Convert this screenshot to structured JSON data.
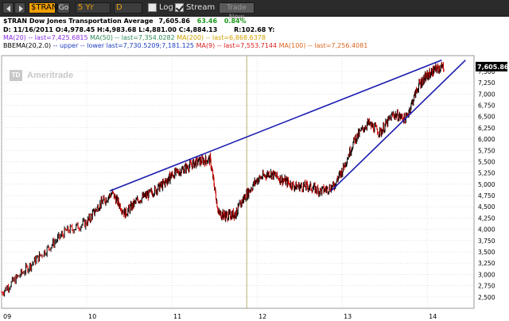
{
  "toolbar": {
    "symbol": "$TRAN",
    "go_label": "Go",
    "period": "5 Yr",
    "interval": "D",
    "log_label": "Log",
    "log_checked": false,
    "stream_label": "Stream",
    "stream_checked": true,
    "trade_label": "Trade Now"
  },
  "header": {
    "title": "$TRAN Dow Jones Transportation Average",
    "last": "7,605.86",
    "change": "63.46",
    "change_pct": "0.84%",
    "ohlc": "D: 11/16/2011  O:4,978.45  H:4,983.68  L:4,881.00  C:4,884.13",
    "range": "R:102.68  Y:",
    "ma_line": [
      {
        "text": "MA(20)",
        "color": "#8a2be2"
      },
      {
        "text": " -- last=7,425.6815 ",
        "color": "#8a2be2"
      },
      {
        "text": "MA(50)",
        "color": "#2e8b57"
      },
      {
        "text": " -- last=7,354.0282 ",
        "color": "#2e8b57"
      },
      {
        "text": "MA(200)",
        "color": "#d2a000"
      },
      {
        "text": " -- last=6,868.6378",
        "color": "#d2a000"
      }
    ],
    "bb_line": [
      {
        "text": "BBEMA(20,2.0)",
        "color": "#000000"
      },
      {
        "text": " -- upper -- lower ",
        "color": "#1e3fbf"
      },
      {
        "text": "last=7,730.5209;7,181.125 ",
        "color": "#1e3fbf"
      },
      {
        "text": "MA(9)",
        "color": "#d81e1e"
      },
      {
        "text": " -- last=7,553.7144 ",
        "color": "#d81e1e"
      },
      {
        "text": "MA(100)",
        "color": "#d8641e"
      },
      {
        "text": " -- last=7,256.4081",
        "color": "#d8641e"
      }
    ]
  },
  "logo_text": "Ameritrade",
  "logo_mark": "TD",
  "chart_data": {
    "type": "ohlc",
    "x": [
      2009.0,
      2009.25,
      2009.5,
      2009.75,
      2010.0,
      2010.15,
      2010.3,
      2010.45,
      2010.6,
      2010.75,
      2010.9,
      2011.0,
      2011.15,
      2011.3,
      2011.45,
      2011.55,
      2011.65,
      2011.75,
      2011.85,
      2012.0,
      2012.15,
      2012.3,
      2012.45,
      2012.6,
      2012.75,
      2012.9,
      2013.0,
      2013.15,
      2013.3,
      2013.45,
      2013.6,
      2013.75,
      2013.9,
      2014.0,
      2014.1,
      2014.2
    ],
    "y": [
      2600,
      3050,
      3500,
      3950,
      4150,
      4550,
      4800,
      4350,
      4650,
      4800,
      5000,
      5200,
      5350,
      5500,
      5550,
      4350,
      4300,
      4350,
      4700,
      5100,
      5250,
      5100,
      4950,
      4950,
      4850,
      4950,
      5300,
      6000,
      6350,
      6150,
      6550,
      6450,
      7200,
      7400,
      7550,
      7605.86
    ],
    "xlim": [
      2009.0,
      2014.55
    ],
    "ylim": [
      2250,
      7850
    ],
    "x_tick_labels": [
      "09",
      "10",
      "11",
      "12",
      "13",
      "14"
    ],
    "y_ticks": [
      2500,
      2750,
      3000,
      3250,
      3500,
      3750,
      4000,
      4250,
      4500,
      4750,
      5000,
      5250,
      5500,
      5750,
      6000,
      6250,
      6500,
      6750,
      7000,
      7250,
      7500
    ],
    "last_value_label": "7,605.86",
    "upper_trendline": [
      [
        2010.27,
        4850
      ],
      [
        2014.17,
        7750
      ]
    ],
    "lower_trendline": [
      [
        2012.87,
        4850
      ],
      [
        2014.45,
        7750
      ]
    ],
    "marker_x": 2011.88,
    "colors": {
      "up": "#000000",
      "down": "#cc0000",
      "trend": "#1a1ab0",
      "grid": "#d0d0d0"
    }
  }
}
